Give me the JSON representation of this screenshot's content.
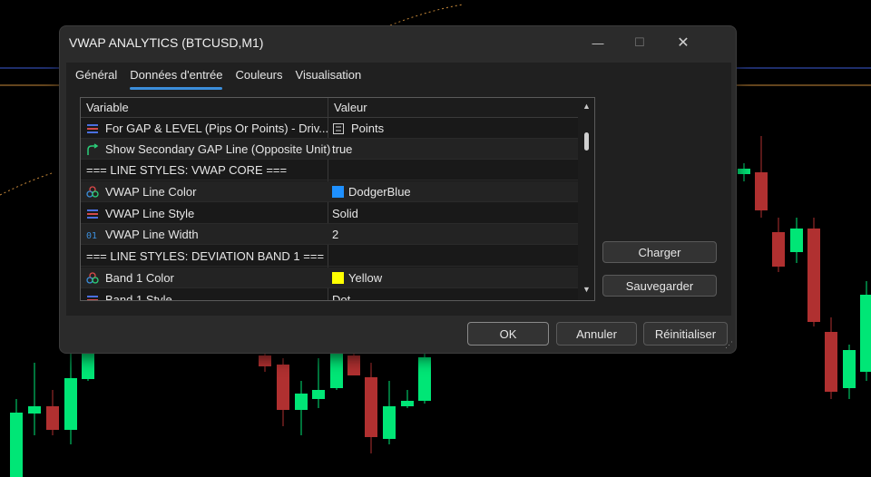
{
  "window": {
    "title": "VWAP ANALYTICS (BTCUSD,M1)",
    "controls": {
      "minimize": "—",
      "maximize": "☐",
      "close": "✕"
    }
  },
  "tabs": [
    {
      "label": "Général",
      "active": false
    },
    {
      "label": "Données d'entrée",
      "active": true
    },
    {
      "label": "Couleurs",
      "active": false
    },
    {
      "label": "Visualisation",
      "active": false
    }
  ],
  "grid": {
    "columns": {
      "name": "Variable",
      "value": "Valeur"
    },
    "rows": [
      {
        "name": "For GAP & LEVEL (Pips Or Points) - Driv...",
        "value": "Points",
        "icon": "enum-icon",
        "value_icon": "list-icon"
      },
      {
        "name": "Show Secondary GAP Line (Opposite Unit)",
        "value": "true",
        "icon": "bool-icon"
      },
      {
        "name": "=== LINE STYLES: VWAP CORE ===",
        "value": "",
        "icon": ""
      },
      {
        "name": "VWAP Line Color",
        "value": "DodgerBlue",
        "icon": "color-icon",
        "swatch": "#1e90ff"
      },
      {
        "name": "VWAP Line Style",
        "value": "Solid",
        "icon": "enum-icon"
      },
      {
        "name": "VWAP Line Width",
        "value": "2",
        "icon": "int-icon"
      },
      {
        "name": "=== LINE STYLES: DEVIATION BAND 1 ===",
        "value": "",
        "icon": ""
      },
      {
        "name": "Band 1 Color",
        "value": "Yellow",
        "icon": "color-icon",
        "swatch": "#ffff00"
      },
      {
        "name": "Band 1 Style",
        "value": "Dot",
        "icon": "enum-icon"
      }
    ]
  },
  "buttons": {
    "load": "Charger",
    "save": "Sauvegarder",
    "ok": "OK",
    "cancel": "Annuler",
    "reset": "Réinitialiser"
  },
  "colors": {
    "accent": "#3b8edb",
    "bull_candle": "#00e676",
    "bear_candle": "#b03030"
  }
}
